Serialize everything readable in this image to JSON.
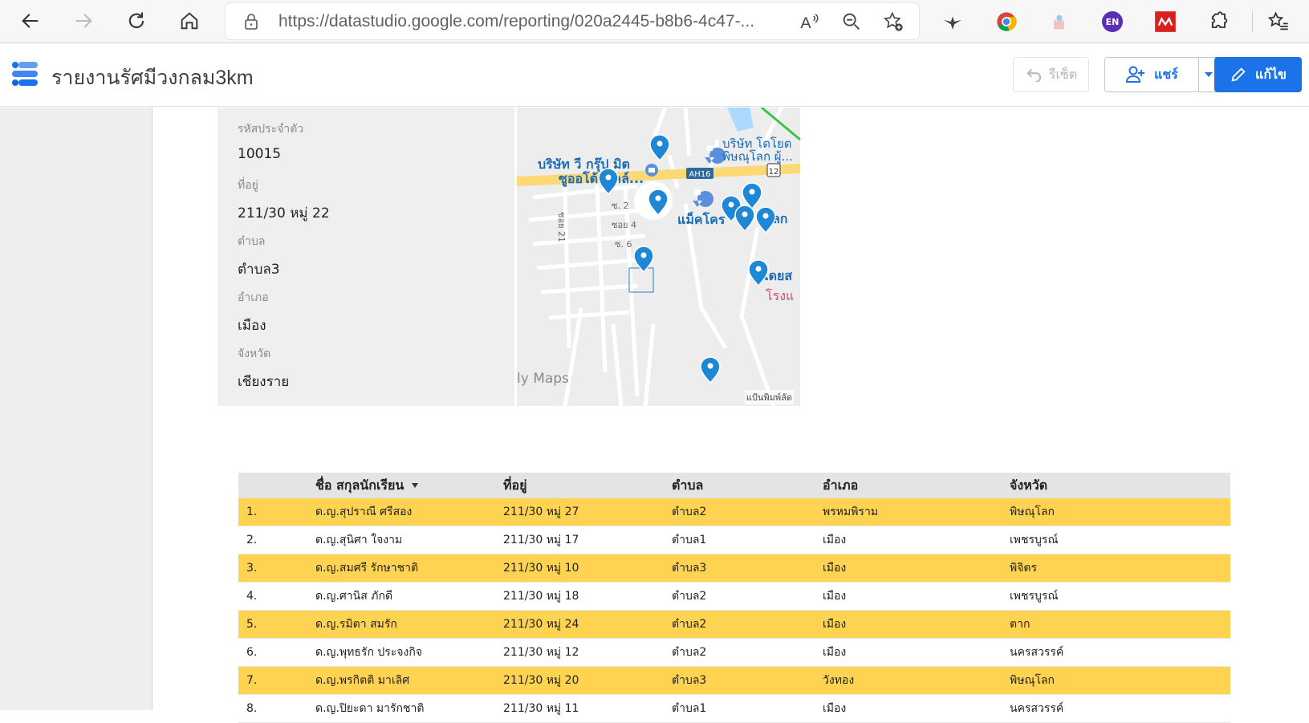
{
  "browser": {
    "url": "https://datastudio.google.com/reporting/020a2445-b8b6-4c47-...",
    "extensions": [
      "crane-extension-icon",
      "chrome-icon",
      "hands-extension-icon",
      "en-extension-icon",
      "mendeley-icon",
      "puzzle-icon"
    ],
    "ext_en_label": "EN"
  },
  "header": {
    "title": "รายงานรัศมีวงกลม3km",
    "reset_label": "รีเซ็ต",
    "share_label": "แชร์",
    "edit_label": "แก้ไข"
  },
  "detail": {
    "fields": [
      {
        "label": "รหัสประจำตัว",
        "value": "10015"
      },
      {
        "label": "ที่อยู่",
        "value": "211/30 หมู่ 22"
      },
      {
        "label": "ตำบล",
        "value": "ตำบล3"
      },
      {
        "label": "อำเภอ",
        "value": "เมือง"
      },
      {
        "label": "จังหวัด",
        "value": "เชียงราย"
      }
    ]
  },
  "map": {
    "credit": "แป้นพิมพ์ลัด",
    "brand": "ly Maps",
    "labels": {
      "company1": "บริษัท วี กรุ๊ป มิต",
      "company1b": "ซูออโต้ออลล์...",
      "company2": "บริษัท โตโยต",
      "company2b": "พิษณุโลก ผู้...",
      "road_ah16": "AH16",
      "road_12": "12",
      "soi2": "ซ. 2",
      "soi4": "ซอย 4",
      "soi6": "ซ. 6",
      "soi21": "ซอย 21",
      "makro": "แม็คโคร",
      "lok": "ลก",
      "doi": "โดยส",
      "hospital": "โรงแ"
    }
  },
  "table": {
    "headers": [
      "",
      "ชื่อ สกุลนักเรียน",
      "ที่อยู่",
      "ตำบล",
      "อำเภอ",
      "จังหวัด"
    ],
    "rows": [
      [
        "1.",
        "ด.ญ.สุปราณี ศรีสอง",
        "211/30 หมู่ 27",
        "ตำบล2",
        "พรหมพิราม",
        "พิษณุโลก"
      ],
      [
        "2.",
        "ด.ญ.สุนิศา ใจงาม",
        "211/30 หมู่ 17",
        "ตำบล1",
        "เมือง",
        "เพชรบูรณ์"
      ],
      [
        "3.",
        "ด.ญ.สมศรี รักษาชาติ",
        "211/30 หมู่ 10",
        "ตำบล3",
        "เมือง",
        "พิจิตร"
      ],
      [
        "4.",
        "ด.ญ.ศานิส ภักดี",
        "211/30 หมู่ 18",
        "ตำบล2",
        "เมือง",
        "เพชรบูรณ์"
      ],
      [
        "5.",
        "ด.ญ.รมิตา สมรัก",
        "211/30 หมู่ 24",
        "ตำบล2",
        "เมือง",
        "ตาก"
      ],
      [
        "6.",
        "ด.ญ.พุทธรัก ประจงกิจ",
        "211/30 หมู่ 12",
        "ตำบล2",
        "เมือง",
        "นครสวรรค์"
      ],
      [
        "7.",
        "ด.ญ.พรกิตติ มาเลิศ",
        "211/30 หมู่ 20",
        "ตำบล3",
        "วังทอง",
        "พิษณุโลก"
      ],
      [
        "8.",
        "ด.ญ.ปิยะดา มารักชาติ",
        "211/30 หมู่ 11",
        "ตำบล1",
        "เมือง",
        "นครสวรรค์"
      ]
    ]
  },
  "colors": {
    "accent": "#1a73e8",
    "row_highlight": "#fdd351",
    "pin": "#1e88d6"
  }
}
